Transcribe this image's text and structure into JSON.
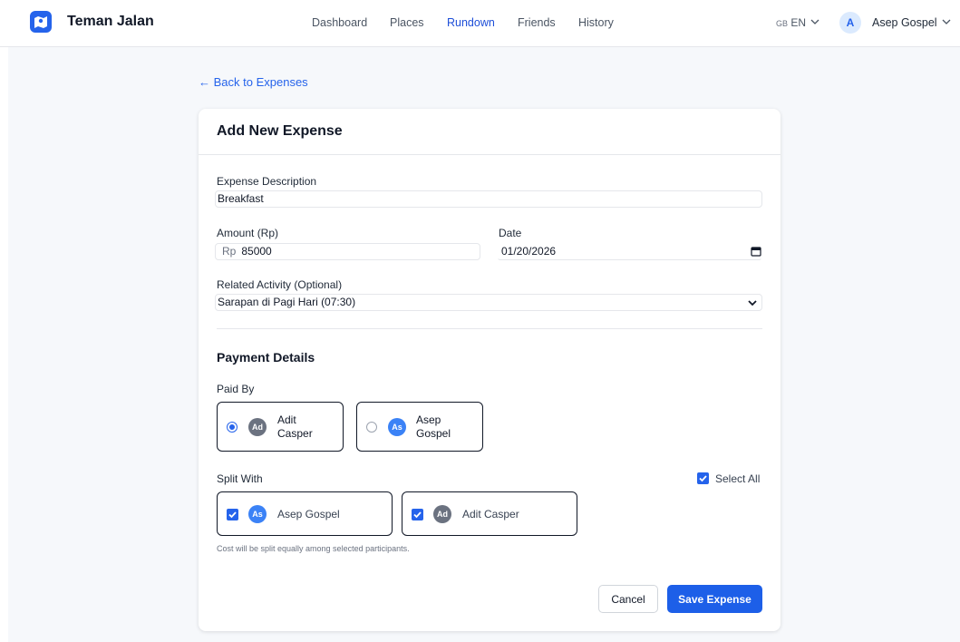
{
  "nav": {
    "brand": "Teman Jalan",
    "links": [
      "Dashboard",
      "Places",
      "Rundown",
      "Friends",
      "History"
    ],
    "active": "Rundown",
    "lang_flag": "GB",
    "lang_code": "EN",
    "user_initial": "A",
    "user_name": "Asep Gospel"
  },
  "back_link": "← Back to Expenses",
  "form": {
    "title": "Add New Expense",
    "description_label": "Expense Description",
    "description_value": "Breakfast",
    "amount_label": "Amount (Rp)",
    "amount_prefix": "Rp",
    "amount_value": "85000",
    "date_label": "Date",
    "date_value": "01/20/2026",
    "activity_label": "Related Activity (Optional)",
    "activity_value": "Sarapan di Pagi Hari (07:30)",
    "payment_title": "Payment Details",
    "paid_by_label": "Paid By",
    "paid_by": [
      {
        "initials": "Ad",
        "first": "Adit",
        "last": "Casper",
        "selected": true
      },
      {
        "initials": "As",
        "first": "Asep",
        "last": "Gospel",
        "selected": false
      }
    ],
    "split_label": "Split With",
    "select_all_label": "Select All",
    "split_with": [
      {
        "initials": "As",
        "name": "Asep Gospel",
        "checked": true
      },
      {
        "initials": "Ad",
        "name": "Adit Casper",
        "checked": true
      }
    ],
    "hint": "Cost will be split equally among selected participants.",
    "cancel_label": "Cancel",
    "save_label": "Save Expense"
  },
  "colors": {
    "accent": "#2563eb",
    "save_button": "#1d5fe8",
    "avatar_grey": "#6b7280",
    "avatar_blue": "#3b82f6"
  }
}
